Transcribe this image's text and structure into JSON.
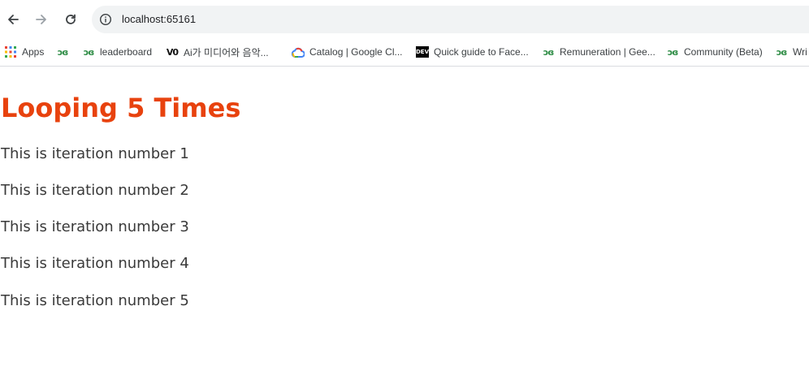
{
  "browser": {
    "url": "localhost:65161",
    "bookmarks": [
      {
        "icon": "apps-grid-icon",
        "label": "Apps"
      },
      {
        "icon": "gfg-logo-icon",
        "label": ""
      },
      {
        "icon": "gfg-logo-icon",
        "label": "leaderboard"
      },
      {
        "icon": "vo-logo-icon",
        "label": "Ai가 미디어와 음악..."
      },
      {
        "icon": "google-cloud-icon",
        "label": "Catalog | Google Cl..."
      },
      {
        "icon": "dev-logo-icon",
        "label": "Quick guide to Face..."
      },
      {
        "icon": "gfg-logo-icon",
        "label": "Remuneration | Gee..."
      },
      {
        "icon": "gfg-logo-icon",
        "label": "Community (Beta)"
      },
      {
        "icon": "gfg-logo-icon",
        "label": "Wri"
      }
    ]
  },
  "page": {
    "heading": "Looping 5 Times",
    "lines": [
      "This is iteration number 1",
      "This is iteration number 2",
      "This is iteration number 3",
      "This is iteration number 4",
      "This is iteration number 5"
    ]
  },
  "colors": {
    "heading": "#e8420e",
    "body_text": "#3a3a3a",
    "gfg_green": "#2f8d46"
  }
}
